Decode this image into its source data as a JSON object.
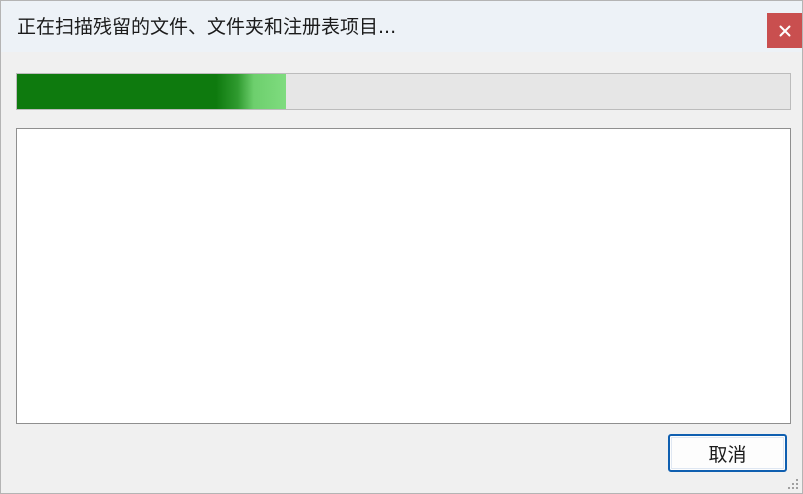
{
  "window": {
    "title": "正在扫描残留的文件、文件夹和注册表项目..."
  },
  "progress": {
    "fraction": 0.348
  },
  "results": {
    "items": []
  },
  "buttons": {
    "cancel_label": "取消"
  },
  "icons": {
    "close": "close-icon",
    "resize": "resize-grip-icon"
  },
  "colors": {
    "progress_fill": "#0e7a0e",
    "progress_tail": "#7fdc7f",
    "close_button_bg": "#c94f4f",
    "focus_border": "#0f5fb0"
  }
}
